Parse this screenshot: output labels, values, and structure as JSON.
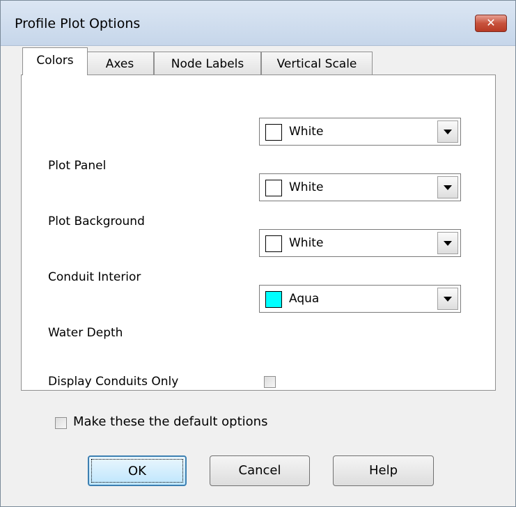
{
  "window": {
    "title": "Profile Plot Options",
    "close_icon": "close-icon"
  },
  "tabs": [
    {
      "label": "Colors",
      "active": true
    },
    {
      "label": "Axes",
      "active": false
    },
    {
      "label": "Node Labels",
      "active": false
    },
    {
      "label": "Vertical Scale",
      "active": false
    }
  ],
  "colors_tab": {
    "rows": [
      {
        "label": "Plot Panel",
        "value": "White",
        "swatch": "#ffffff"
      },
      {
        "label": "Plot Background",
        "value": "White",
        "swatch": "#ffffff"
      },
      {
        "label": "Conduit Interior",
        "value": "White",
        "swatch": "#ffffff"
      },
      {
        "label": "Water Depth",
        "value": "Aqua",
        "swatch": "#00ffff"
      }
    ],
    "display_conduits_only": {
      "label": "Display Conduits Only",
      "checked": false
    }
  },
  "default_options": {
    "label": "Make these the default options",
    "checked": false
  },
  "buttons": {
    "ok": "OK",
    "cancel": "Cancel",
    "help": "Help"
  }
}
